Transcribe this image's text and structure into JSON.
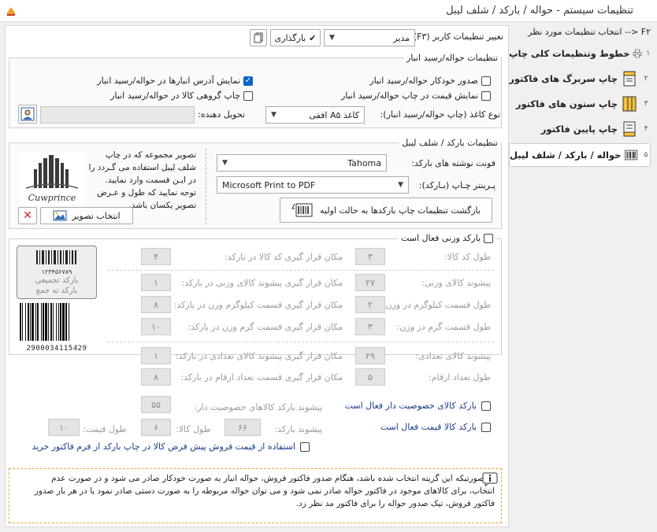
{
  "window": {
    "title": "تنظیمات سیستم - حواله / بارکد / شلف لیبل"
  },
  "sidebar": {
    "header": "F۲ <-- انتخاب تنظیمات مورد نظر",
    "items": [
      {
        "num": "۱",
        "label": "خطوط وتنظیمات کلی چاپ",
        "icon": "printer-icon"
      },
      {
        "num": "۲",
        "label": "چاپ سربرگ های فاکتور",
        "icon": "header-doc-icon"
      },
      {
        "num": "۳",
        "label": "چاپ ستون های فاکتور",
        "icon": "columns-icon"
      },
      {
        "num": "۴",
        "label": "چاپ پایین فاکتور",
        "icon": "footer-doc-icon"
      },
      {
        "num": "۵",
        "label": "حواله / بارکد / شلف لیبل",
        "icon": "barcode-icon"
      }
    ]
  },
  "top": {
    "user_settings_label": "تغییر تنظیمات کاربر (F۳):",
    "user_value": "مدیر",
    "load_button": "بارگذاری"
  },
  "transfer": {
    "title": "تنظیمات حواله/رسید انبار",
    "opt_auto_issue": "صدور خودکار حواله/رسید انبار",
    "opt_show_price": "نمایش قیمت در چاپ حواله/رسید انبار",
    "opt_show_address": "نمایش آدرس انبارها در حواله/رسید انبار",
    "opt_group_print": "چاپ گروهی کالا در حواله/رسید انبار",
    "paper_label": "نوع کاغذ (چاپ حواله/رسید انبار):",
    "paper_value": "کاغذ A۵ افقی",
    "deliverer_label": "تحویل دهنده:"
  },
  "barcode": {
    "title": "تنظیمات بارکد / شلف لیبل",
    "font_label": "فونت نوشته های بارکد:",
    "font_value": "Tahoma",
    "printer_label": "پـرینتر چـاپ (بـارکد):",
    "printer_value": "Microsoft Print to PDF",
    "reset_button": "بازگشت تنظیمات چاپ بارکدها به حالت اولیه",
    "image_desc": "تصویر مجموعه که در چاپ شلف لیبل استفاده می گـردد را در ایـن قسمت وارد نمایید. توجه نمایید که طول و عـرض تصویر یکسان باشد.",
    "select_image_button": "انتخاب تصویر",
    "logo_text": "Cuwprince"
  },
  "weight": {
    "enable_label": "بارکد وزنی فعال است",
    "rows_right": [
      {
        "label": "طول کد کالا:",
        "value": "۳"
      },
      {
        "label": "پیشوند کالای وزنی:",
        "value": "۲۷"
      },
      {
        "label": "طول قسمت کیلوگرم در وزن:",
        "value": "۲"
      },
      {
        "label": "طول قسمت گرم در وزن:",
        "value": "۳"
      },
      {
        "label": "پیشوند کالای تعدادی:",
        "value": "۲۹"
      },
      {
        "label": "طول تعداد ارقام:",
        "value": "۵"
      }
    ],
    "rows_left": [
      {
        "label": "مکان قرار گیری کد کالا در بارکد:",
        "value": "۴"
      },
      {
        "label": "مکان قرار گیری پیشوند کالای وزنی در بارکد:",
        "value": "۱"
      },
      {
        "label": "مکان قرار گیری قسمت کیلوگرم وزن در بارکد:",
        "value": "۸"
      },
      {
        "label": "مکان قرار گیری قسمت گرم وزن در بارکد:",
        "value": "۱۰"
      },
      {
        "label": "مکان قرار گیری پیشوند کالای تعدادی در بارکد:",
        "value": "۱"
      },
      {
        "label": "مکان قرار گیری قسمت تعداد ارقام در بارکد:",
        "value": "۸"
      }
    ],
    "sample_barcode_digits": "۱۲۳۴۵۶۷۸۹",
    "sample_line1": "بارکد تجمیعی",
    "sample_line2": "بارکد ته جمع",
    "barcode_number": "2900034115429"
  },
  "special": {
    "enable_label": "بارکد کالای خصوصیت دار فعال است",
    "prefix_label": "پیشوند بارکد کالاهای خصوصیت دار:",
    "prefix_value": "۵۵"
  },
  "price": {
    "enable_label": "بارکد کالا قیمت فعال است",
    "prefix_label": "پیشوند بارکد:",
    "prefix_value": "۶۶",
    "length_label": "طول کالا:",
    "length_value": "۶",
    "price_length_label": "طول قیمت:",
    "price_length_value": "۱۰",
    "use_default_price": "استفاده از قیمت فروش پیش فرض کالا در چاپ بارکد از فرم فاکتور خرید"
  },
  "info": {
    "text": "در صورتیکه این گزینه انتخاب شده باشد، هنگام صدور فاکتور فروش، حواله انبار به صورت خودکار صادر می شود و در صورت عدم انتخاب، برای کالاهای موجود در فاکتور حواله صادر نمی شود و می توان حواله مربوطه را به صورت دستی صادر نمود یا در هر بار صدور فاکتور فروش، تیک صدور حواله را برای فاکتور مد نظر زد."
  }
}
